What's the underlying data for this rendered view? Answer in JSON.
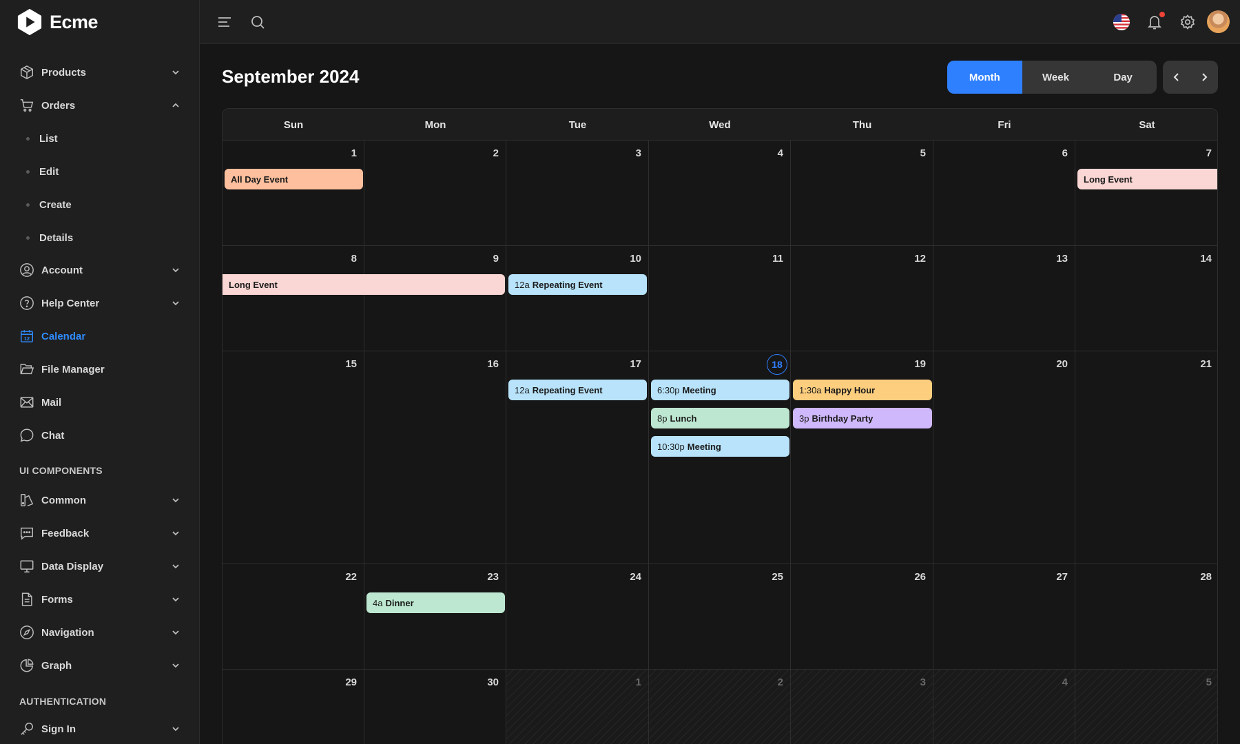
{
  "brand": {
    "name": "Ecme"
  },
  "sidebar": {
    "items": [
      {
        "label": "Products",
        "icon": "box-icon",
        "expanded": false
      },
      {
        "label": "Orders",
        "icon": "cart-icon",
        "expanded": true,
        "children": [
          "List",
          "Edit",
          "Create",
          "Details"
        ]
      },
      {
        "label": "Account",
        "icon": "user-circle-icon",
        "expanded": false
      },
      {
        "label": "Help Center",
        "icon": "help-circle-icon",
        "expanded": false
      },
      {
        "label": "Calendar",
        "icon": "calendar-icon",
        "active": true
      },
      {
        "label": "File Manager",
        "icon": "folder-icon"
      },
      {
        "label": "Mail",
        "icon": "mail-icon"
      },
      {
        "label": "Chat",
        "icon": "chat-icon"
      }
    ],
    "sections": [
      {
        "title": "UI COMPONENTS",
        "items": [
          "Common",
          "Feedback",
          "Data Display",
          "Forms",
          "Navigation",
          "Graph"
        ]
      },
      {
        "title": "AUTHENTICATION",
        "items": [
          "Sign In"
        ]
      }
    ]
  },
  "header": {
    "icons": [
      "menu-icon",
      "search-icon",
      "us-flag-icon",
      "bell-icon",
      "gear-icon",
      "avatar"
    ]
  },
  "calendar": {
    "title": "September 2024",
    "views": [
      "Month",
      "Week",
      "Day"
    ],
    "active_view": "Month",
    "weekdays": [
      "Sun",
      "Mon",
      "Tue",
      "Wed",
      "Thu",
      "Fri",
      "Sat"
    ],
    "today": "18",
    "weeks": [
      [
        "1",
        "2",
        "3",
        "4",
        "5",
        "6",
        "7"
      ],
      [
        "8",
        "9",
        "10",
        "11",
        "12",
        "13",
        "14"
      ],
      [
        "15",
        "16",
        "17",
        "18",
        "19",
        "20",
        "21"
      ],
      [
        "22",
        "23",
        "24",
        "25",
        "26",
        "27",
        "28"
      ],
      [
        "29",
        "30",
        "1",
        "2",
        "3",
        "4",
        "5"
      ]
    ],
    "events": [
      {
        "title": "All Day Event",
        "time": "",
        "color": "#fdbf9d"
      },
      {
        "title": "Long Event",
        "time": "",
        "color": "#fad7d4"
      },
      {
        "title": "Long Event",
        "time": "",
        "color": "#fad7d4"
      },
      {
        "title": "Repeating Event",
        "time": "12a",
        "color": "#b8e3fb"
      },
      {
        "title": "Repeating Event",
        "time": "12a",
        "color": "#b8e3fb"
      },
      {
        "title": "Meeting",
        "time": "6:30p",
        "color": "#b8e3fb"
      },
      {
        "title": "Lunch",
        "time": "8p",
        "color": "#bde7d0"
      },
      {
        "title": "Meeting",
        "time": "10:30p",
        "color": "#b8e3fb"
      },
      {
        "title": "Happy Hour",
        "time": "1:30a",
        "color": "#fdce7e"
      },
      {
        "title": "Birthday Party",
        "time": "3p",
        "color": "#cfb8fb"
      },
      {
        "title": "Dinner",
        "time": "4a",
        "color": "#bde7d0"
      }
    ]
  }
}
